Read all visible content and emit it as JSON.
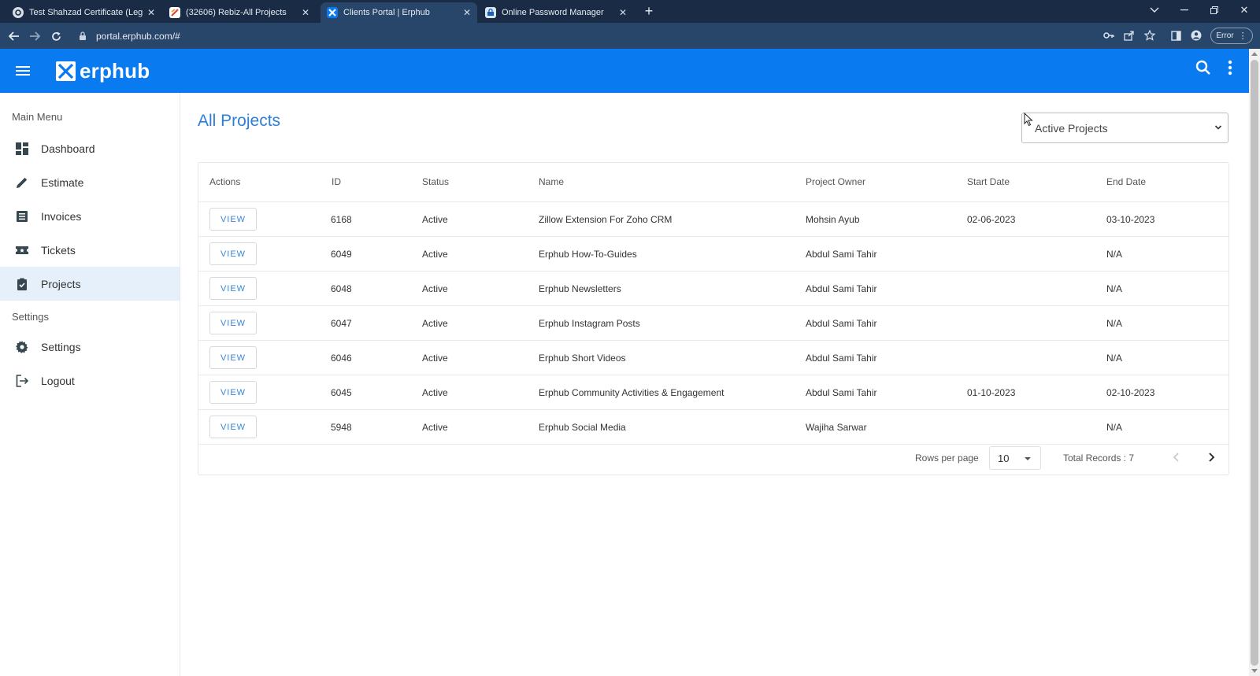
{
  "browser": {
    "tabs": [
      {
        "title": "Test Shahzad Certificate (Legal C",
        "icon": "gear-badge-icon",
        "active": false
      },
      {
        "title": "(32606) Rebiz-All Projects",
        "icon": "rebiz-favicon",
        "active": false
      },
      {
        "title": "Clients Portal | Erphub",
        "icon": "erphub-favicon",
        "active": true
      },
      {
        "title": "Online Password Manager",
        "icon": "password-manager-favicon",
        "active": false
      }
    ],
    "url": "portal.erphub.com/#",
    "error_label": "Error"
  },
  "app": {
    "brand": "erphub",
    "colors": {
      "primary": "#0a7af0",
      "accent_text": "#2d7fd6",
      "active_nav": "#e6f0fb"
    }
  },
  "sidebar": {
    "main_menu_label": "Main Menu",
    "settings_label": "Settings",
    "items": [
      {
        "label": "Dashboard",
        "icon": "dashboard-icon"
      },
      {
        "label": "Estimate",
        "icon": "pencil-icon"
      },
      {
        "label": "Invoices",
        "icon": "list-icon"
      },
      {
        "label": "Tickets",
        "icon": "ticket-icon"
      },
      {
        "label": "Projects",
        "icon": "clipboard-check-icon",
        "active": true
      }
    ],
    "settings_items": [
      {
        "label": "Settings",
        "icon": "gear-icon"
      },
      {
        "label": "Logout",
        "icon": "logout-icon"
      }
    ]
  },
  "main": {
    "title": "All Projects",
    "filter": {
      "selected": "Active Projects"
    },
    "table": {
      "columns": [
        "Actions",
        "ID",
        "Status",
        "Name",
        "Project Owner",
        "Start Date",
        "End Date"
      ],
      "view_label": "VIEW",
      "rows": [
        {
          "id": "6168",
          "status": "Active",
          "name": "Zillow Extension For Zoho CRM",
          "owner": "Mohsin Ayub",
          "start": "02-06-2023",
          "end": "03-10-2023"
        },
        {
          "id": "6049",
          "status": "Active",
          "name": "Erphub How-To-Guides",
          "owner": "Abdul Sami Tahir",
          "start": "",
          "end": "N/A"
        },
        {
          "id": "6048",
          "status": "Active",
          "name": "Erphub Newsletters",
          "owner": "Abdul Sami Tahir",
          "start": "",
          "end": "N/A"
        },
        {
          "id": "6047",
          "status": "Active",
          "name": "Erphub Instagram Posts",
          "owner": "Abdul Sami Tahir",
          "start": "",
          "end": "N/A"
        },
        {
          "id": "6046",
          "status": "Active",
          "name": "Erphub Short Videos",
          "owner": "Abdul Sami Tahir",
          "start": "",
          "end": "N/A"
        },
        {
          "id": "6045",
          "status": "Active",
          "name": "Erphub Community Activities & Engagement",
          "owner": "Abdul Sami Tahir",
          "start": "01-10-2023",
          "end": "02-10-2023"
        },
        {
          "id": "5948",
          "status": "Active",
          "name": "Erphub Social Media",
          "owner": "Wajiha Sarwar",
          "start": "",
          "end": "N/A"
        }
      ]
    },
    "pagination": {
      "rows_per_page_label": "Rows per page",
      "rows_per_page": "10",
      "total_records": "Total Records : 7"
    }
  }
}
